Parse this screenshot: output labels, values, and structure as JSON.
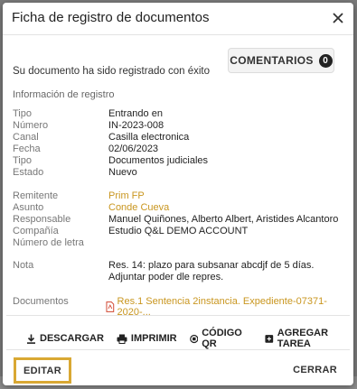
{
  "dialog": {
    "title": "Ficha de registro de documentos",
    "comments_label": "COMENTARIOS",
    "comments_count": "0",
    "success_message": "Su documento ha sido registrado con éxito",
    "section_title": "Información de registro"
  },
  "fields": {
    "tipo": {
      "label": "Tipo",
      "value": "Entrando en"
    },
    "numero": {
      "label": "Número",
      "value": "IN-2023-008"
    },
    "canal": {
      "label": "Canal",
      "value": "Casilla electronica"
    },
    "fecha": {
      "label": "Fecha",
      "value": "02/06/2023"
    },
    "tipo2": {
      "label": "Tipo",
      "value": "Documentos judiciales"
    },
    "estado": {
      "label": "Estado",
      "value": "Nuevo"
    },
    "remitente": {
      "label": "Remitente",
      "value": "Prim FP"
    },
    "asunto": {
      "label": "Asunto",
      "value": "Conde Cueva"
    },
    "responsable": {
      "label": "Responsable",
      "value": "Manuel Quiñones, Alberto Albert, Aristides Alcantoro"
    },
    "compania": {
      "label": "Compañía",
      "value": "Estudio Q&L DEMO ACCOUNT"
    },
    "numero_letra": {
      "label": "Número de letra",
      "value": ""
    },
    "nota": {
      "label": "Nota",
      "value": "Res. 14: plazo para subsanar abcdjf de 5 días. Adjuntar poder dle repres."
    },
    "documentos": {
      "label": "Documentos",
      "value": "Res.1 Sentencia 2instancia. Expediente-07371-2020-..."
    }
  },
  "actions": {
    "download": "DESCARGAR",
    "print": "IMPRIMIR",
    "qr": "CÓDIGO QR",
    "add_task": "AGREGAR TAREA"
  },
  "footer": {
    "edit": "EDITAR",
    "close": "CERRAR"
  },
  "colors": {
    "accent": "#c9961f",
    "edit_border": "#d9a833"
  }
}
